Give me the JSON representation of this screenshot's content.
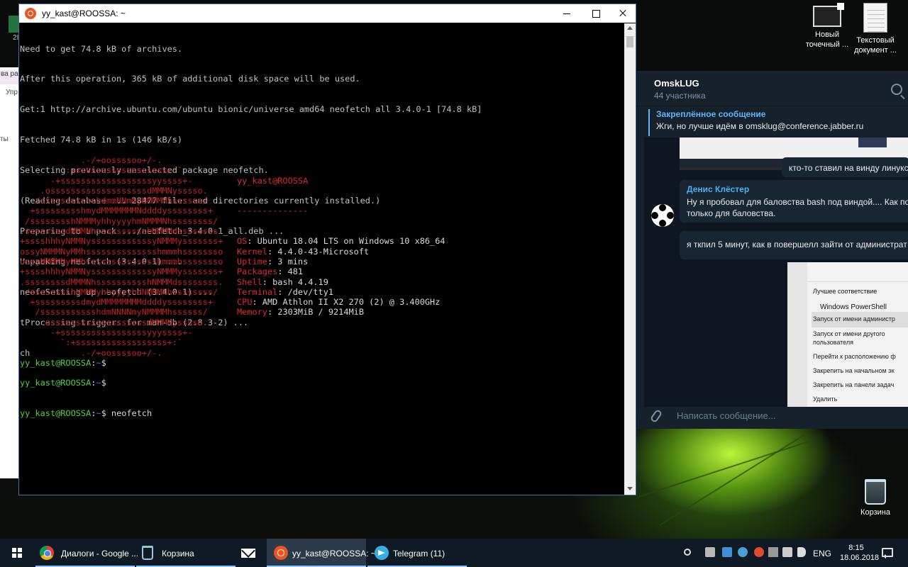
{
  "desktop": {
    "icons": [
      {
        "label_line1": "Новый",
        "label_line2": "точечный ..."
      },
      {
        "label_line1": "Текстовый",
        "label_line2": "документ ..."
      },
      {
        "label_line1": "Корзина",
        "label_line2": ""
      }
    ],
    "left_fragments": {
      "tab": "ва ра",
      "line1": "Упр",
      "line2": "ты",
      "edge": "2I"
    }
  },
  "terminal": {
    "title": "yy_kast@ROOSSA: ~",
    "output_lines": [
      "Need to get 74.8 kB of archives.",
      "After this operation, 365 kB of additional disk space will be used.",
      "Get:1 http://archive.ubuntu.com/ubuntu bionic/universe amd64 neofetch all 3.4.0-1 [74.8 kB]",
      "Fetched 74.8 kB in 1s (146 kB/s)",
      "Selecting previously unselected package neofetch.",
      "(Reading database ... 28477 files and directories currently installed.)",
      "Preparing to unpack .../neofetch_3.4.0-1_all.deb ...",
      "Unpacking neofetch (3.4.0-1) ...",
      "neofeSetting up neofetch (3.4.0-1) ...",
      "tProcessing triggers for man-db (2.8.3-2) ...",
      "ch"
    ],
    "prompt_user": "yy_kast@ROOSSA",
    "prompt_path": "~",
    "prompt_symbol": "$",
    "command": "neofetch",
    "neofetch_art": [
      "            .-/+oossssoo+/-.",
      "        `:+ssssssssssssssssss+:`",
      "      -+ssssssssssssssssssyyssss+-",
      "    .osssssssssssssssssssdMMMNysssso.",
      "   /ssssssssssshdmmNNmmyNMMMMhssssss/",
      "  +ssssssssshmydMMMMMMMNddddyssssssss+",
      " /sssssssshNMMMyhhyyyyhmNMMMNhssssssss/",
      ".ssssssssdMMMNhsssssssssshNMMMdssssssss.",
      "+sssshhhyNMMNyssssssssssssyNMMMysssssss+",
      "ossyNMMMNyMMhsssssssssssssshmmmhssssssso",
      "ossyNMMMNyMMhsssssssssssssshmmmhssssssso",
      "+sssshhhyNMMNyssssssssssssyNMMMysssssss+",
      ".ssssssssdMMMNhsssssssssshNMMMdssssssss.",
      " /sssssssshNMMMyhhyyyyhdNMMMNhssssssss/",
      "  +sssssssssdmydMMMMMMMMddddyssssssss+",
      "   /ssssssssssshdmNNNNmyNMMMMhssssss/",
      "    .osssssssssssssssssssdMMMNysssso.",
      "      -+sssssssssssssssssyyyssss+-",
      "        `:+ssssssssssssssssss+:`",
      "            .-/+oossssoo+/-."
    ],
    "info_title": "yy_kast@ROOSSA",
    "info_sep": "--------------",
    "info": [
      {
        "key": "OS",
        "value": "Ubuntu 18.04 LTS on Windows 10 x86_64"
      },
      {
        "key": "Kernel",
        "value": "4.4.0-43-Microsoft"
      },
      {
        "key": "Uptime",
        "value": "3 mins"
      },
      {
        "key": "Packages",
        "value": "481"
      },
      {
        "key": "Shell",
        "value": "bash 4.4.19"
      },
      {
        "key": "Terminal",
        "value": "/dev/tty1"
      },
      {
        "key": "CPU",
        "value": "AMD Athlon II X2 270 (2) @ 3.400GHz"
      },
      {
        "key": "Memory",
        "value": "2303MiB / 9214MiB"
      }
    ]
  },
  "telegram": {
    "chat_title": "OmskLUG",
    "chat_subtitle": "44 участника",
    "pinned_title": "Закреплённое сообщение",
    "pinned_text": "Жги, но лучше идём в omsklug@conference.jabber.ru",
    "msg1": "кто-то ставил на винду линукс?",
    "msg2_author": "Денис Клёстер",
    "msg2_line1": "Ну я пробовал для баловства bash под виндой.... Как по м",
    "msg2_line2": "только для баловства.",
    "msg3": "я ткпил 5 минут, как в повершелл зайти от администрат",
    "shot2": {
      "best_match": "Лучшее соответствие",
      "app": "Windows PowerShell",
      "items": [
        "Запуск от имени администр",
        "Запуск от имени другого",
        "пользователя",
        "Перейти к расположению ф",
        "Закрепить на начальном эк",
        "Закрепить на панели задач",
        "Удалить"
      ]
    },
    "input_placeholder": "Написать сообщение..."
  },
  "taskbar": {
    "items": [
      {
        "label": "Диалоги - Google ..."
      },
      {
        "label": "Корзина"
      },
      {
        "label": ""
      },
      {
        "label": "yy_kast@ROOSSA: ~"
      },
      {
        "label": "Telegram (11)"
      }
    ],
    "lang": "ENG",
    "time": "8:15",
    "date": "18.06.2018"
  },
  "colors": {
    "accent": "#3b78ff",
    "prompt_green": "#4cd33a",
    "neofetch_red": "#c42121",
    "telegram_bg": "#17212b"
  }
}
